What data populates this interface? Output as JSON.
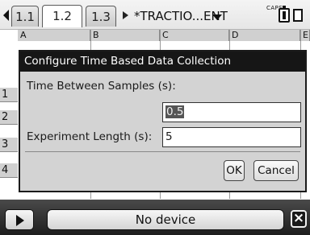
{
  "tabs": [
    {
      "label": "1.1",
      "active": false
    },
    {
      "label": "1.2",
      "active": true
    },
    {
      "label": "1.3",
      "active": false
    }
  ],
  "document": {
    "title": "*TRACTIO...ENT"
  },
  "status": {
    "caps": "CAPS"
  },
  "spreadsheet": {
    "columns": [
      "A",
      "B",
      "C",
      "D",
      "E"
    ],
    "rows": [
      "1",
      "2",
      "3",
      "4"
    ]
  },
  "dialog": {
    "title": "Configure Time Based Data Collection",
    "time_between_label": "Time Between Samples (s):",
    "time_between_value": "0.5",
    "experiment_length_label": "Experiment Length (s):",
    "experiment_length_value": "5",
    "ok_label": "OK",
    "cancel_label": "Cancel"
  },
  "device_bar": {
    "status": "No device"
  }
}
